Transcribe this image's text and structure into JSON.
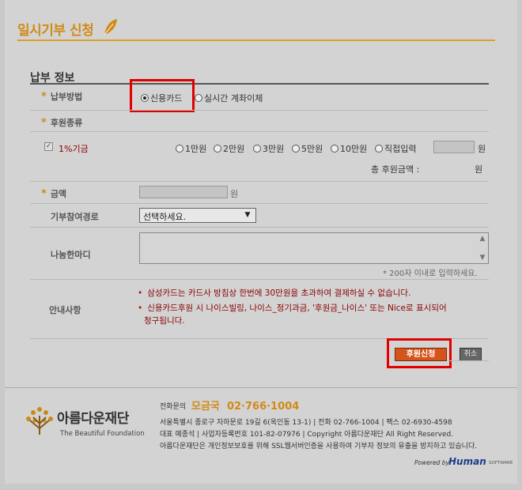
{
  "page": {
    "title": "일시기부 신청",
    "section_title": "납부 정보"
  },
  "colors": {
    "accent": "#d28a16",
    "highlight": "#e00000",
    "notice": "#8b0000"
  },
  "payment": {
    "label": "납부방법",
    "options": [
      "신용카드",
      "실시간 계좌이체"
    ],
    "selected": "신용카드"
  },
  "support_type": {
    "label": "후원종류"
  },
  "one_percent": {
    "label": "1%기금",
    "amounts": [
      "1만원",
      "2만원",
      "3만원",
      "5만원",
      "10만원",
      "직접입력"
    ],
    "unit": "원"
  },
  "total": {
    "label": "총 후원금액 :",
    "unit": "원"
  },
  "amount": {
    "label": "금액",
    "unit": "원"
  },
  "route": {
    "label": "기부참여경로",
    "select_value": "선택하세요."
  },
  "message": {
    "label": "나눔한마디",
    "hint": "* 200자 이내로 입력하세요."
  },
  "notice": {
    "label": "안내사항",
    "lines": [
      "삼성카드는 카드사 방침상 한번에 30만원을 초과하여 결제하실 수 없습니다.",
      "신용카드후원 시 나이스빌링, 나이스_정기과금, '후원금_나이스' 또는 Nice로 표시되어",
      "청구됩니다."
    ]
  },
  "buttons": {
    "submit": "후원신청",
    "cancel": "취소"
  },
  "footer": {
    "logo_ko": "아름다운재단",
    "logo_en": "The Beautiful Foundation",
    "tel_label": "전화문의",
    "tel_name": "모금국",
    "tel_number": "02·766·1004",
    "address": "서울특별시 종로구 자하문로 19길 6(옥인동 13-1) | 전화 02-766-1004 | 팩스 02-6930-4598",
    "registration": "대표 예종석 | 사업자등록번호 101-82-07976 | Copyright 아름다운재단 All Right Reserved.",
    "privacy": "아름다운재단은 개인정보보호를 위해 SSL웹서버인증을 사용하여 기부자 정보의 유출을 방지하고 있습니다.",
    "powered_by": "Powered by",
    "vendor": "Human",
    "vendor_suffix": "SOFTWARE"
  }
}
